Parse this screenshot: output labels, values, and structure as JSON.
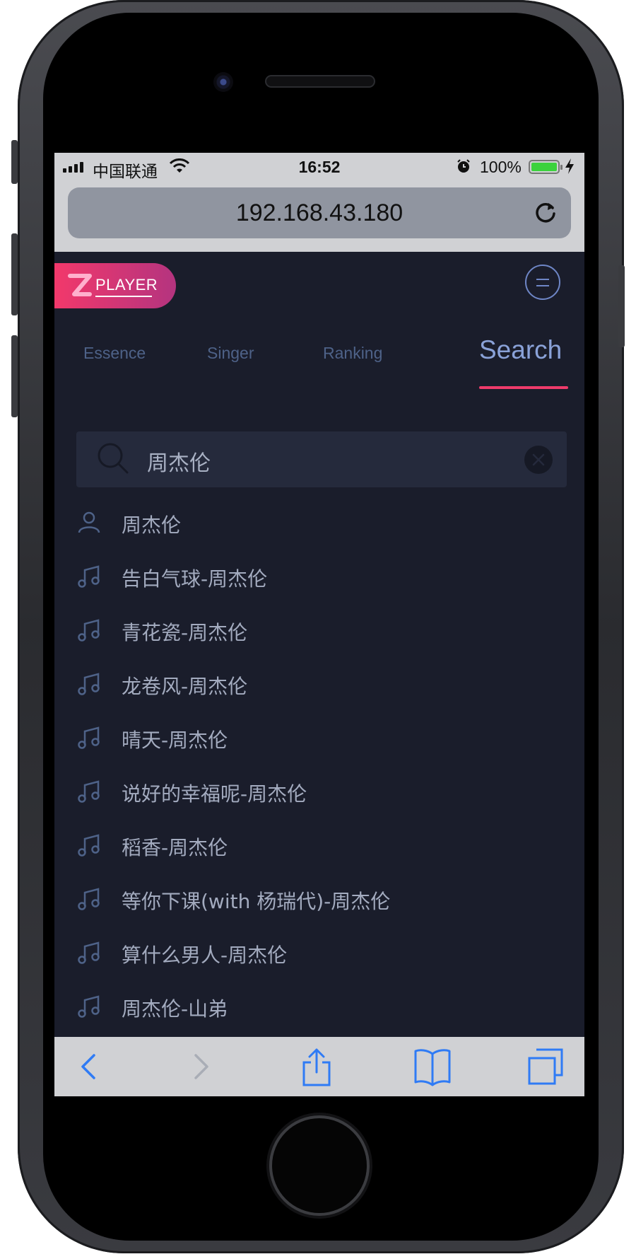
{
  "status_bar": {
    "carrier": "中国联通",
    "time": "16:52",
    "battery": "100%"
  },
  "browser": {
    "url": "192.168.43.180"
  },
  "app": {
    "logo_text": "PLAYER",
    "tabs": [
      {
        "label": "Essence"
      },
      {
        "label": "Singer"
      },
      {
        "label": "Ranking"
      },
      {
        "label": "Search",
        "active": true
      }
    ],
    "search": {
      "value": "周杰伦"
    },
    "results": [
      {
        "type": "singer",
        "icon": "user-icon",
        "text": "周杰伦"
      },
      {
        "type": "song",
        "icon": "music-note-icon",
        "text": "告白气球-周杰伦"
      },
      {
        "type": "song",
        "icon": "music-note-icon",
        "text": "青花瓷-周杰伦"
      },
      {
        "type": "song",
        "icon": "music-note-icon",
        "text": "龙卷风-周杰伦"
      },
      {
        "type": "song",
        "icon": "music-note-icon",
        "text": "晴天-周杰伦"
      },
      {
        "type": "song",
        "icon": "music-note-icon",
        "text": "说好的幸福呢-周杰伦"
      },
      {
        "type": "song",
        "icon": "music-note-icon",
        "text": "稻香-周杰伦"
      },
      {
        "type": "song",
        "icon": "music-note-icon",
        "text": "等你下课(with 杨瑞代)-周杰伦"
      },
      {
        "type": "song",
        "icon": "music-note-icon",
        "text": "算什么男人-周杰伦"
      },
      {
        "type": "song",
        "icon": "music-note-icon",
        "text": "周杰伦-山弟"
      }
    ]
  },
  "colors": {
    "background": "#1a1d2b",
    "accent": "#ee3b6b",
    "active_tab": "#8aa2d8",
    "inactive_tab": "#4e6288",
    "ios_blue": "#2f7bf5"
  }
}
